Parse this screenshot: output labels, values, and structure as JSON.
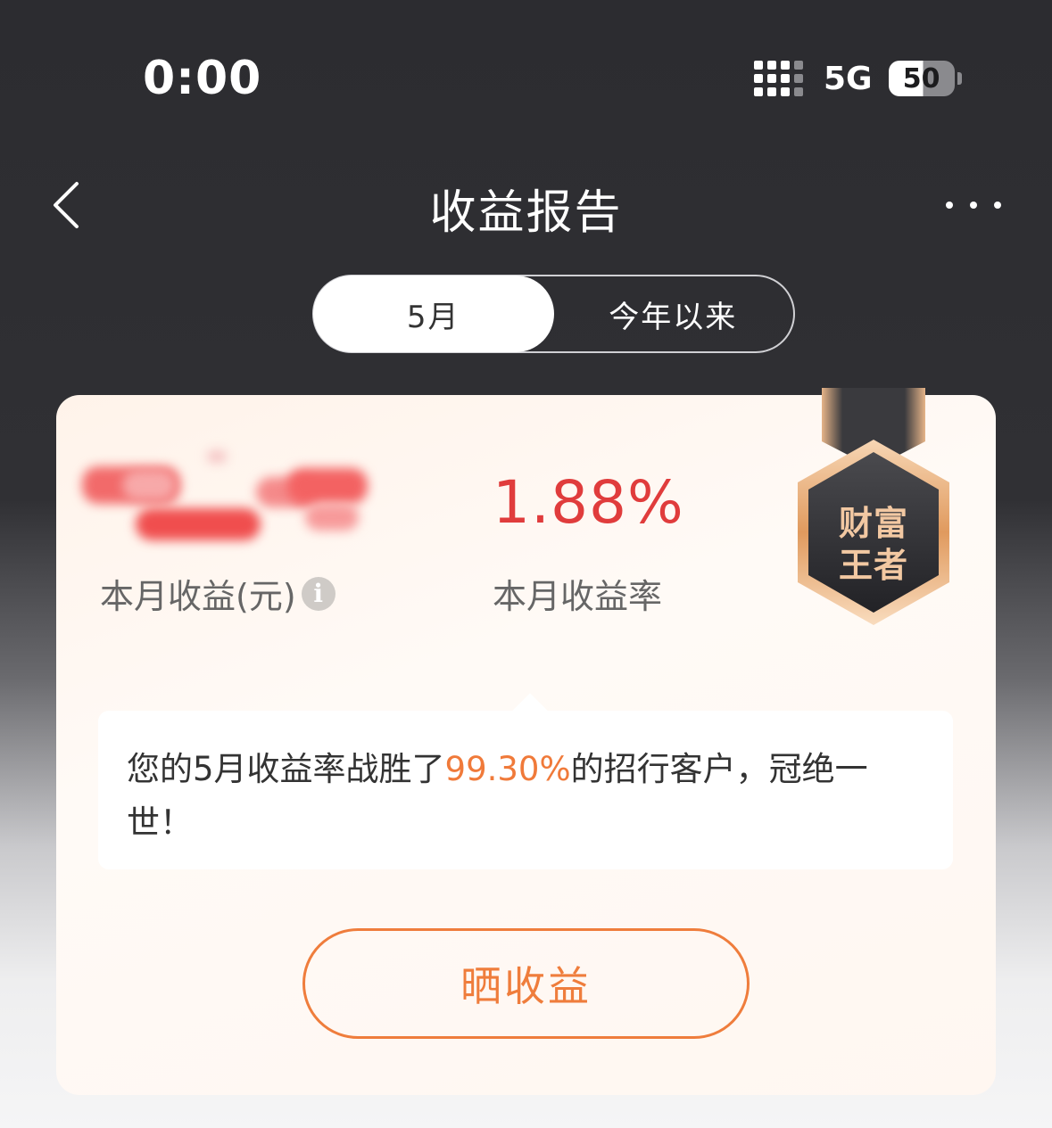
{
  "status_bar": {
    "time": "0:00",
    "network": "5G",
    "battery": "50"
  },
  "nav": {
    "title": "收益报告",
    "back_icon": "chevron-left-icon",
    "more_icon": "more-horizontal-icon"
  },
  "segment": {
    "tabs": [
      "5月",
      "今年以来"
    ],
    "active_index": 0
  },
  "summary": {
    "income_label": "本月收益(元)",
    "income_value_hidden": true,
    "rate_value": "1.88%",
    "rate_label": "本月收益率"
  },
  "badge": {
    "line1": "财富",
    "line2": "王者"
  },
  "message": {
    "prefix": "您的5月收益率战胜了",
    "highlight": "99.30%",
    "suffix": "的招行客户，冠绝一世！"
  },
  "share_button": {
    "label": "晒收益"
  },
  "colors": {
    "background_dark": "#2c2c30",
    "rate_red": "#e03c3c",
    "accent_orange": "#ef7d3c",
    "highlight_orange": "#f07a3a",
    "card_bg": "#fff3ea"
  }
}
